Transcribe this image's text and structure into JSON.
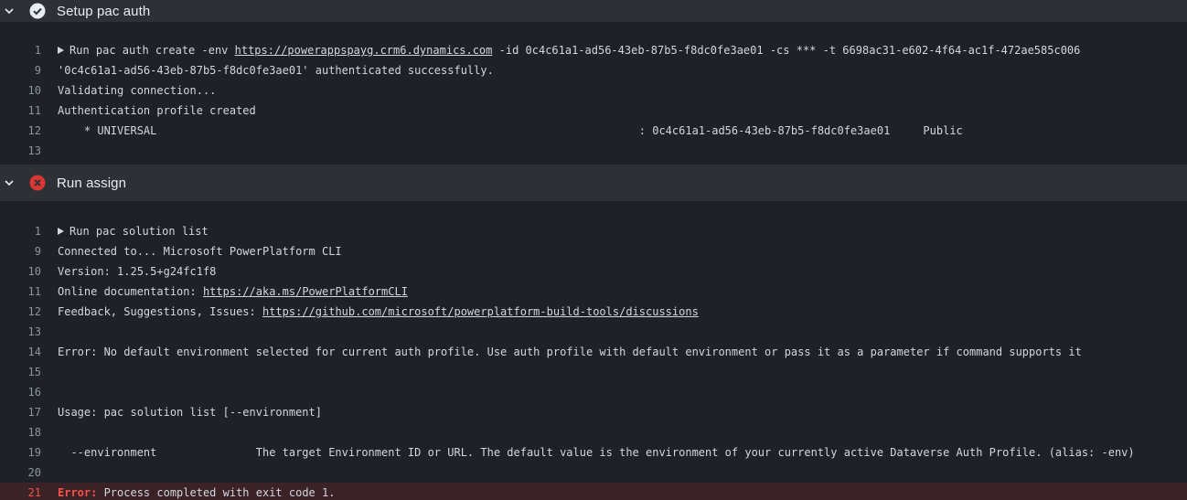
{
  "colors": {
    "success": "#e6edf3",
    "failure": "#da3633",
    "error_text": "#f85149",
    "error_row_bg": "#3b2226"
  },
  "sections": [
    {
      "title": "Setup pac auth",
      "status": "success",
      "status_icon": "check-circle-icon",
      "lines": [
        {
          "num": "1",
          "prefix": "Run pac auth create -env ",
          "link": "https://powerappspayg.crm6.dynamics.com",
          "suffix": " -id 0c4c61a1-ad56-43eb-87b5-f8dc0fe3ae01 -cs *** -t 6698ac31-e602-4f64-ac1f-472ae585c006"
        },
        {
          "num": "9",
          "text": "'0c4c61a1-ad56-43eb-87b5-f8dc0fe3ae01' authenticated successfully."
        },
        {
          "num": "10",
          "text": "Validating connection..."
        },
        {
          "num": "11",
          "text": "Authentication profile created"
        },
        {
          "num": "12",
          "text": "    * UNIVERSAL                                                                         : 0c4c61a1-ad56-43eb-87b5-f8dc0fe3ae01     Public"
        },
        {
          "num": "13",
          "text": ""
        }
      ]
    },
    {
      "title": "Run assign",
      "status": "failure",
      "status_icon": "x-circle-icon",
      "lines": [
        {
          "num": "1",
          "text": "Run pac solution list"
        },
        {
          "num": "9",
          "text": "Connected to... Microsoft PowerPlatform CLI"
        },
        {
          "num": "10",
          "text": "Version: 1.25.5+g24fc1f8"
        },
        {
          "num": "11",
          "prefix": "Online documentation: ",
          "link": "https://aka.ms/PowerPlatformCLI"
        },
        {
          "num": "12",
          "prefix": "Feedback, Suggestions, Issues: ",
          "link": "https://github.com/microsoft/powerplatform-build-tools/discussions"
        },
        {
          "num": "13",
          "text": ""
        },
        {
          "num": "14",
          "text": "Error: No default environment selected for current auth profile. Use auth profile with default environment or pass it as a parameter if command supports it"
        },
        {
          "num": "15",
          "text": ""
        },
        {
          "num": "16",
          "text": ""
        },
        {
          "num": "17",
          "text": "Usage: pac solution list [--environment]"
        },
        {
          "num": "18",
          "text": ""
        },
        {
          "num": "19",
          "text": "  --environment               The target Environment ID or URL. The default value is the environment of your currently active Dataverse Auth Profile. (alias: -env)"
        },
        {
          "num": "20",
          "text": ""
        },
        {
          "num": "21",
          "err_label": "Error:",
          "text": " Process completed with exit code 1."
        }
      ]
    }
  ]
}
